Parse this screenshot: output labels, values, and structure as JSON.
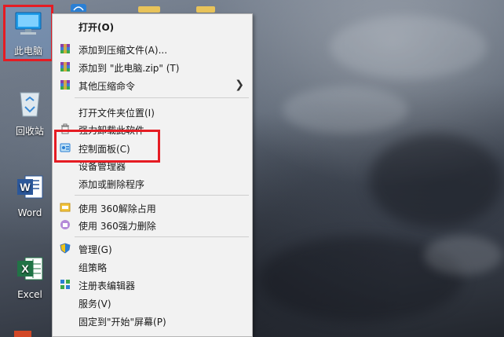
{
  "desktop": {
    "icons": [
      {
        "label": "此电脑"
      },
      {
        "label": "回收站"
      },
      {
        "label": "Word"
      },
      {
        "label": "Excel"
      }
    ]
  },
  "menu": {
    "items": [
      {
        "label": "打开(O)"
      },
      {
        "label": "添加到压缩文件(A)..."
      },
      {
        "label": "添加到 \"此电脑.zip\" (T)"
      },
      {
        "label": "其他压缩命令"
      },
      {
        "label": "打开文件夹位置(I)"
      },
      {
        "label": "强力卸载此软件"
      },
      {
        "label": "控制面板(C)"
      },
      {
        "label": "设备管理器"
      },
      {
        "label": "添加或删除程序"
      },
      {
        "label": "使用 360解除占用"
      },
      {
        "label": "使用 360强力删除"
      },
      {
        "label": "管理(G)"
      },
      {
        "label": "组策略"
      },
      {
        "label": "注册表编辑器"
      },
      {
        "label": "服务(V)"
      },
      {
        "label": "固定到\"开始\"屏幕(P)"
      }
    ]
  },
  "colors": {
    "highlight_border": "#e51c23",
    "menu_bg": "#f2f2f2"
  }
}
